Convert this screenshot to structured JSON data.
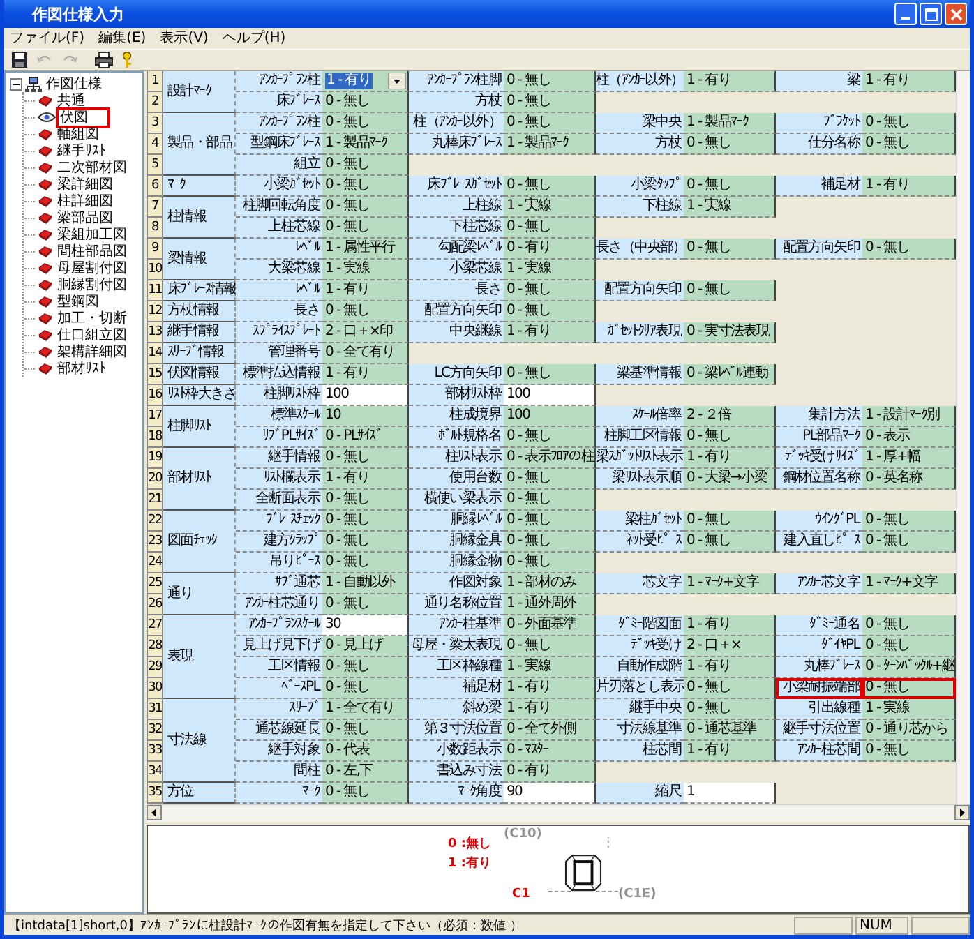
{
  "window": {
    "title": "作図仕様入力"
  },
  "menu": [
    "ファイル(F)",
    "編集(E)",
    "表示(V)",
    "ヘルプ(H)"
  ],
  "toolbar": [
    {
      "kind": "save",
      "disabled": false
    },
    {
      "kind": "undo",
      "disabled": true
    },
    {
      "kind": "redo",
      "disabled": true
    },
    {
      "kind": "print",
      "disabled": false
    },
    {
      "kind": "help",
      "disabled": false
    }
  ],
  "tree": {
    "label": "作図仕様",
    "expanded": true,
    "children": [
      {
        "label": "共通",
        "selected": false
      },
      {
        "label": "伏図",
        "selected": true
      },
      {
        "label": "軸組図",
        "selected": false
      },
      {
        "label": "継手ﾘｽﾄ",
        "selected": false
      },
      {
        "label": "二次部材図",
        "selected": false
      },
      {
        "label": "梁詳細図",
        "selected": false
      },
      {
        "label": "柱詳細図",
        "selected": false
      },
      {
        "label": "梁部品図",
        "selected": false
      },
      {
        "label": "梁組加工図",
        "selected": false
      },
      {
        "label": "間柱部品図",
        "selected": false
      },
      {
        "label": "母屋割付図",
        "selected": false
      },
      {
        "label": "胴縁割付図",
        "selected": false
      },
      {
        "label": "型鋼図",
        "selected": false
      },
      {
        "label": "加工・切断",
        "selected": false
      },
      {
        "label": "仕口組立図",
        "selected": false
      },
      {
        "label": "架構詳細図",
        "selected": false
      },
      {
        "label": "部材ﾘｽﾄ",
        "selected": false
      }
    ]
  },
  "grid": {
    "groups": [
      {
        "label": "設計ﾏｰｸ",
        "rows": [
          {
            "num": "1",
            "fields": [
              {
                "label": "ｱﾝｶｰﾌﾟﾗﾝ柱",
                "value": "1 - 有り",
                "kind": "dropdown"
              },
              {
                "label": "ｱﾝｶｰﾌﾟﾗﾝ柱脚",
                "value": "0 - 無し",
                "kind": "choice"
              },
              {
                "label": "柱（ｱﾝｶｰ以外）",
                "value": "1 - 有り",
                "kind": "choice"
              },
              {
                "label": "梁",
                "value": "1 - 有り",
                "kind": "choice"
              }
            ]
          },
          {
            "num": "2",
            "fields": [
              {
                "label": "床ﾌﾞﾚｰｽ",
                "value": "0 - 無し",
                "kind": "choice"
              },
              {
                "label": "方杖",
                "value": "0 - 無し",
                "kind": "choice"
              }
            ]
          }
        ]
      },
      {
        "label": "製品・部品",
        "rows": [
          {
            "num": "3",
            "fields": [
              {
                "label": "ｱﾝｶｰﾌﾟﾗﾝ柱",
                "value": "0 - 無し",
                "kind": "choice"
              },
              {
                "label": "柱（ｱﾝｶｰ以外）",
                "value": "0 - 無し",
                "kind": "choice"
              },
              {
                "label": "梁中央",
                "value": "1 - 製品ﾏｰｸ",
                "kind": "choice"
              },
              {
                "label": "ﾌﾞﾗｹｯﾄ",
                "value": "0 - 無し",
                "kind": "choice"
              }
            ]
          },
          {
            "num": "4",
            "fields": [
              {
                "label": "型鋼床ﾌﾞﾚｰｽ",
                "value": "1 - 製品ﾏｰｸ",
                "kind": "choice"
              },
              {
                "label": "丸棒床ﾌﾞﾚｰｽ",
                "value": "1 - 製品ﾏｰｸ",
                "kind": "choice"
              },
              {
                "label": "方杖",
                "value": "0 - 無し",
                "kind": "choice"
              },
              {
                "label": "仕分名称",
                "value": "0 - 無し",
                "kind": "choice"
              }
            ]
          },
          {
            "num": "5",
            "fields": [
              {
                "label": "組立",
                "value": "0 - 無し",
                "kind": "choice"
              }
            ]
          }
        ]
      },
      {
        "label": "ﾏｰｸ",
        "rows": [
          {
            "num": "6",
            "fields": [
              {
                "label": "小梁ｶﾞｾｯﾄ",
                "value": "0 - 無し",
                "kind": "choice"
              },
              {
                "label": "床ﾌﾞﾚｰｽｶﾞｾｯﾄ",
                "value": "0 - 無し",
                "kind": "choice"
              },
              {
                "label": "小梁ﾀｯﾌﾟ",
                "value": "0 - 無し",
                "kind": "choice"
              },
              {
                "label": "補足材",
                "value": "1 - 有り",
                "kind": "choice"
              }
            ]
          }
        ]
      },
      {
        "label": "柱情報",
        "rows": [
          {
            "num": "7",
            "fields": [
              {
                "label": "柱脚回転角度",
                "value": "0 - 無し",
                "kind": "choice"
              },
              {
                "label": "上柱線",
                "value": "1 - 実線",
                "kind": "choice"
              },
              {
                "label": "下柱線",
                "value": "1 - 実線",
                "kind": "choice"
              }
            ]
          },
          {
            "num": "8",
            "fields": [
              {
                "label": "上柱芯線",
                "value": "0 - 無し",
                "kind": "choice"
              },
              {
                "label": "下柱芯線",
                "value": "0 - 無し",
                "kind": "choice"
              }
            ]
          }
        ]
      },
      {
        "label": "梁情報",
        "rows": [
          {
            "num": "9",
            "fields": [
              {
                "label": "ﾚﾍﾞﾙ",
                "value": "1 - 属性平行",
                "kind": "choice"
              },
              {
                "label": "勾配梁ﾚﾍﾞﾙ",
                "value": "0 - 有り",
                "kind": "choice"
              },
              {
                "label": "長さ（中央部）",
                "value": "0 - 無し",
                "kind": "choice"
              },
              {
                "label": "配置方向矢印",
                "value": "0 - 無し",
                "kind": "choice"
              }
            ]
          },
          {
            "num": "10",
            "fields": [
              {
                "label": "大梁芯線",
                "value": "1 - 実線",
                "kind": "choice"
              },
              {
                "label": "小梁芯線",
                "value": "1 - 実線",
                "kind": "choice"
              }
            ]
          }
        ]
      },
      {
        "label": "床ﾌﾞﾚｰｽ情報",
        "rows": [
          {
            "num": "11",
            "fields": [
              {
                "label": "ﾚﾍﾞﾙ",
                "value": "1 - 有り",
                "kind": "choice"
              },
              {
                "label": "長さ",
                "value": "0 - 無し",
                "kind": "choice"
              },
              {
                "label": "配置方向矢印",
                "value": "0 - 無し",
                "kind": "choice"
              }
            ]
          }
        ]
      },
      {
        "label": "方杖情報",
        "rows": [
          {
            "num": "12",
            "fields": [
              {
                "label": "長さ",
                "value": "0 - 無し",
                "kind": "choice"
              },
              {
                "label": "配置方向矢印",
                "value": "0 - 無し",
                "kind": "choice"
              }
            ]
          }
        ]
      },
      {
        "label": "継手情報",
        "rows": [
          {
            "num": "13",
            "fields": [
              {
                "label": "ｽﾌﾟﾗｲｽﾌﾟﾚｰﾄ",
                "value": "2 - 口＋×印",
                "kind": "choice"
              },
              {
                "label": "中央継線",
                "value": "1 - 有り",
                "kind": "choice"
              },
              {
                "label": "ｶﾞｾｯﾄｸﾘｱ表現",
                "value": "0 - 実寸法表現",
                "kind": "choice"
              }
            ]
          }
        ]
      },
      {
        "label": "ｽﾘｰﾌﾞ情報",
        "rows": [
          {
            "num": "14",
            "fields": [
              {
                "label": "管理番号",
                "value": "0 - 全て有り",
                "kind": "choice"
              }
            ]
          }
        ]
      },
      {
        "label": "伏図情報",
        "rows": [
          {
            "num": "15",
            "fields": [
              {
                "label": "標準払込情報",
                "value": "1 - 有り",
                "kind": "choice"
              },
              {
                "label": "LC方向矢印",
                "value": "0 - 無し",
                "kind": "choice"
              },
              {
                "label": "梁基準情報",
                "value": "0 - 梁ﾚﾍﾞﾙ連動",
                "kind": "choice"
              }
            ]
          }
        ]
      },
      {
        "label": "ﾘｽﾄ枠大きさ",
        "rows": [
          {
            "num": "16",
            "fields": [
              {
                "label": "柱脚ﾘｽﾄ枠",
                "value": "100",
                "kind": "number"
              },
              {
                "label": "部材ﾘｽﾄ枠",
                "value": "100",
                "kind": "number"
              }
            ]
          }
        ]
      },
      {
        "label": "柱脚ﾘｽﾄ",
        "rows": [
          {
            "num": "17",
            "fields": [
              {
                "label": "標準ｽｹｰﾙ",
                "value": "10",
                "kind": "choice"
              },
              {
                "label": "柱成境界",
                "value": "100",
                "kind": "choice"
              },
              {
                "label": "ｽｹｰﾙ倍率",
                "value": "2 - ２倍",
                "kind": "choice"
              },
              {
                "label": "集計方法",
                "value": "1 - 設計ﾏｰｸ別",
                "kind": "choice"
              }
            ]
          },
          {
            "num": "18",
            "fields": [
              {
                "label": "ﾘﾌﾞPLｻｲｽﾞ",
                "value": "0 - PLｻｲｽﾞ",
                "kind": "choice"
              },
              {
                "label": "ﾎﾞﾙﾄ規格名",
                "value": "0 - 無し",
                "kind": "choice"
              },
              {
                "label": "柱脚工区情報",
                "value": "0 - 無し",
                "kind": "choice"
              },
              {
                "label": "PL部品ﾏｰｸ",
                "value": "0 - 表示",
                "kind": "choice"
              }
            ]
          }
        ]
      },
      {
        "label": "部材ﾘｽﾄ",
        "rows": [
          {
            "num": "19",
            "fields": [
              {
                "label": "継手情報",
                "value": "0 - 無し",
                "kind": "choice"
              },
              {
                "label": "柱ﾘｽﾄ表示",
                "value": "0 - 表示ﾌﾛｱの柱",
                "kind": "choice"
              },
              {
                "label": "梁ｽｶﾞｯﾄﾘｽﾄ表示",
                "value": "1 - 有り",
                "kind": "choice"
              },
              {
                "label": "ﾃﾞｯｷ受けｻｲｽﾞ",
                "value": "1 - 厚+幅",
                "kind": "choice"
              }
            ]
          },
          {
            "num": "20",
            "fields": [
              {
                "label": "ﾘｽﾄ欄表示",
                "value": "1 - 有り",
                "kind": "choice"
              },
              {
                "label": "使用台数",
                "value": "0 - 無し",
                "kind": "choice"
              },
              {
                "label": "梁ﾘｽﾄ表示順",
                "value": "0 - 大梁→小梁",
                "kind": "choice"
              },
              {
                "label": "鋼材位置名称",
                "value": "0 - 英名称",
                "kind": "choice"
              }
            ]
          },
          {
            "num": "21",
            "fields": [
              {
                "label": "全断面表示",
                "value": "0 - 無し",
                "kind": "choice"
              },
              {
                "label": "横使い梁表示",
                "value": "0 - 無し",
                "kind": "choice"
              }
            ]
          }
        ]
      },
      {
        "label": "図面ﾁｪｯｸ",
        "rows": [
          {
            "num": "22",
            "fields": [
              {
                "label": "ﾌﾞﾚｰｽﾁｪｯｸ",
                "value": "0 - 無し",
                "kind": "choice"
              },
              {
                "label": "胴縁ﾚﾍﾞﾙ",
                "value": "0 - 無し",
                "kind": "choice"
              },
              {
                "label": "梁柱ｶﾞｾｯﾄ",
                "value": "0 - 無し",
                "kind": "choice"
              },
              {
                "label": "ｳｲﾝｸﾞPL",
                "value": "0 - 無し",
                "kind": "choice"
              }
            ]
          },
          {
            "num": "23",
            "fields": [
              {
                "label": "建方ｸﾗｯﾌﾟ",
                "value": "0 - 無し",
                "kind": "choice"
              },
              {
                "label": "胴縁金具",
                "value": "0 - 無し",
                "kind": "choice"
              },
              {
                "label": "ﾈｯﾄ受ﾋﾟｰｽ",
                "value": "0 - 無し",
                "kind": "choice"
              },
              {
                "label": "建入直しﾋﾟｰｽ",
                "value": "0 - 無し",
                "kind": "choice"
              }
            ]
          },
          {
            "num": "24",
            "fields": [
              {
                "label": "吊りﾋﾟｰｽ",
                "value": "0 - 無し",
                "kind": "choice"
              },
              {
                "label": "胴縁金物",
                "value": "0 - 無し",
                "kind": "choice"
              }
            ]
          }
        ]
      },
      {
        "label": "通り",
        "rows": [
          {
            "num": "25",
            "fields": [
              {
                "label": "ｻﾌﾞ通芯",
                "value": "1 - 自動以外",
                "kind": "choice"
              },
              {
                "label": "作図対象",
                "value": "1 - 部材のみ",
                "kind": "choice"
              },
              {
                "label": "芯文字",
                "value": "1 - ﾏｰｸ+文字",
                "kind": "choice"
              },
              {
                "label": "ｱﾝｶｰ芯文字",
                "value": "1 - ﾏｰｸ+文字",
                "kind": "choice"
              }
            ]
          },
          {
            "num": "26",
            "fields": [
              {
                "label": "ｱﾝｶｰ柱芯通り",
                "value": "0 - 無し",
                "kind": "choice"
              },
              {
                "label": "通り名称位置",
                "value": "1 - 通外周外",
                "kind": "choice"
              }
            ]
          }
        ]
      },
      {
        "label": "表現",
        "rows": [
          {
            "num": "27",
            "fields": [
              {
                "label": "ｱﾝｶｰﾌﾟﾗﾝｽｹｰﾙ",
                "value": "30",
                "kind": "number"
              },
              {
                "label": "ｱﾝｶｰ柱基準",
                "value": "0 - 外面基準",
                "kind": "choice"
              },
              {
                "label": "ﾀﾞﾐｰ階図面",
                "value": "1 - 有り",
                "kind": "choice"
              },
              {
                "label": "ﾀﾞﾐｰ通名",
                "value": "0 - 無し",
                "kind": "choice"
              }
            ]
          },
          {
            "num": "28",
            "fields": [
              {
                "label": "見上げ見下げ",
                "value": "0 - 見上げ",
                "kind": "choice"
              },
              {
                "label": "母屋・梁太表現",
                "value": "0 - 無し",
                "kind": "choice"
              },
              {
                "label": "ﾃﾞｯｷ受け",
                "value": "2 - 口＋×",
                "kind": "choice"
              },
              {
                "label": "ﾀﾞｲﾔPL",
                "value": "0 - 無し",
                "kind": "choice"
              }
            ]
          },
          {
            "num": "29",
            "fields": [
              {
                "label": "工区情報",
                "value": "0 - 無し",
                "kind": "choice"
              },
              {
                "label": "工区枠線種",
                "value": "1 - 実線",
                "kind": "choice"
              },
              {
                "label": "自動作成階",
                "value": "1 - 有り",
                "kind": "choice"
              },
              {
                "label": "丸棒ﾌﾞﾚｰｽ",
                "value": "0 - ﾀｰﾝﾊﾞｯｸﾙ+継",
                "kind": "choice"
              }
            ]
          },
          {
            "num": "30",
            "fields": [
              {
                "label": "ﾍﾞｰｽPL",
                "value": "0 - 無し",
                "kind": "choice"
              },
              {
                "label": "補足材",
                "value": "1 - 有り",
                "kind": "choice"
              },
              {
                "label": "片刃落とし表示",
                "value": "0 - 無し",
                "kind": "choice"
              },
              {
                "label": "小梁耐振端部",
                "value": "0 - 無し",
                "kind": "marked"
              }
            ]
          }
        ]
      },
      {
        "label": "寸法線",
        "rows": [
          {
            "num": "31",
            "fields": [
              {
                "label": "ｽﾘｰﾌﾞ",
                "value": "1 - 全て有り",
                "kind": "choice"
              },
              {
                "label": "斜め梁",
                "value": "1 - 有り",
                "kind": "choice"
              },
              {
                "label": "継手中央",
                "value": "0 - 無し",
                "kind": "choice"
              },
              {
                "label": "引出線種",
                "value": "1 - 実線",
                "kind": "choice"
              }
            ]
          },
          {
            "num": "32",
            "fields": [
              {
                "label": "通芯線延長",
                "value": "0 - 無し",
                "kind": "choice"
              },
              {
                "label": "第３寸法位置",
                "value": "0 - 全て外側",
                "kind": "choice"
              },
              {
                "label": "寸法線基準",
                "value": "0 - 通芯基準",
                "kind": "choice"
              },
              {
                "label": "継手寸法位置",
                "value": "0 - 通り芯から",
                "kind": "choice"
              }
            ]
          },
          {
            "num": "33",
            "fields": [
              {
                "label": "継手対象",
                "value": "0 - 代表",
                "kind": "choice"
              },
              {
                "label": "小数距表示",
                "value": "0 - ﾏｽﾀｰ",
                "kind": "choice"
              },
              {
                "label": "柱芯間",
                "value": "1 - 有り",
                "kind": "choice"
              },
              {
                "label": "ｱﾝｶｰ柱芯間",
                "value": "0 - 無し",
                "kind": "choice"
              }
            ]
          },
          {
            "num": "34",
            "fields": [
              {
                "label": "間柱",
                "value": "0 - 左,下",
                "kind": "choice"
              },
              {
                "label": "書込み寸法",
                "value": "0 - 有り",
                "kind": "choice"
              }
            ]
          }
        ]
      },
      {
        "label": "方位",
        "rows": [
          {
            "num": "35",
            "fields": [
              {
                "label": "ﾏｰｸ",
                "value": "0 - 無し",
                "kind": "choice"
              },
              {
                "label": "ﾏｰｸ角度",
                "value": "90",
                "kind": "number"
              },
              {
                "label": "縮尺",
                "value": "1",
                "kind": "number"
              }
            ]
          }
        ]
      }
    ]
  },
  "preview": {
    "labels": [
      {
        "text": "0 :無し",
        "color": "#e00000"
      },
      {
        "text": "1 :有り",
        "color": "#e00000"
      },
      {
        "text": "(C10)",
        "color": "#909090"
      },
      {
        "text": "C1",
        "color": "#e00000"
      },
      {
        "text": "(C1E)",
        "color": "#909090"
      }
    ]
  },
  "status_bar": {
    "message": "【intdata[1]short,0】ｱﾝｶｰﾌﾟﾗﾝに柱設計ﾏｰｸの作図有無を指定して下さい（必須：数値 ）",
    "indicator": "NUM"
  }
}
